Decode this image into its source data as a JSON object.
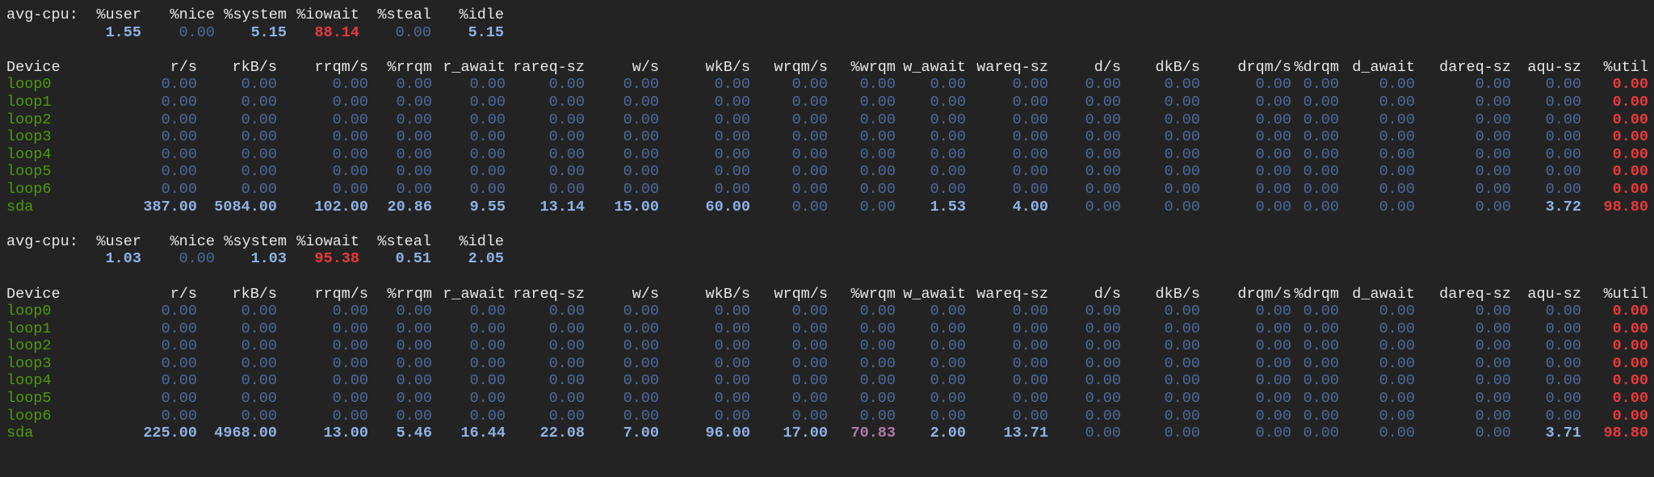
{
  "colors": {
    "background": "#232323",
    "label": "#e6e6e6",
    "zero_value": "#4d6a9c",
    "nonzero_value": "#8fb2e6",
    "critical_value": "#e83a3a",
    "warning_value": "#b07aa8",
    "device_name": "#4e9a06"
  },
  "cpu_label": "avg-cpu:",
  "cpu_headers": [
    "%user",
    "%nice",
    "%system",
    "%iowait",
    "%steal",
    "%idle"
  ],
  "device_headers": [
    "Device",
    "r/s",
    "rkB/s",
    "rrqm/s",
    "%rrqm",
    "r_await",
    "rareq-sz",
    "w/s",
    "wkB/s",
    "wrqm/s",
    "%wrqm",
    "w_await",
    "wareq-sz",
    "d/s",
    "dkB/s",
    "drqm/s",
    "%drqm",
    "d_await",
    "dareq-sz",
    "aqu-sz",
    "%util"
  ],
  "reports": [
    {
      "cpu_values": [
        "1.55",
        "0.00",
        "5.15",
        "88.14",
        "0.00",
        "5.15"
      ],
      "devices": [
        {
          "name": "loop0",
          "values": [
            "0.00",
            "0.00",
            "0.00",
            "0.00",
            "0.00",
            "0.00",
            "0.00",
            "0.00",
            "0.00",
            "0.00",
            "0.00",
            "0.00",
            "0.00",
            "0.00",
            "0.00",
            "0.00",
            "0.00",
            "0.00",
            "0.00",
            "0.00"
          ]
        },
        {
          "name": "loop1",
          "values": [
            "0.00",
            "0.00",
            "0.00",
            "0.00",
            "0.00",
            "0.00",
            "0.00",
            "0.00",
            "0.00",
            "0.00",
            "0.00",
            "0.00",
            "0.00",
            "0.00",
            "0.00",
            "0.00",
            "0.00",
            "0.00",
            "0.00",
            "0.00"
          ]
        },
        {
          "name": "loop2",
          "values": [
            "0.00",
            "0.00",
            "0.00",
            "0.00",
            "0.00",
            "0.00",
            "0.00",
            "0.00",
            "0.00",
            "0.00",
            "0.00",
            "0.00",
            "0.00",
            "0.00",
            "0.00",
            "0.00",
            "0.00",
            "0.00",
            "0.00",
            "0.00"
          ]
        },
        {
          "name": "loop3",
          "values": [
            "0.00",
            "0.00",
            "0.00",
            "0.00",
            "0.00",
            "0.00",
            "0.00",
            "0.00",
            "0.00",
            "0.00",
            "0.00",
            "0.00",
            "0.00",
            "0.00",
            "0.00",
            "0.00",
            "0.00",
            "0.00",
            "0.00",
            "0.00"
          ]
        },
        {
          "name": "loop4",
          "values": [
            "0.00",
            "0.00",
            "0.00",
            "0.00",
            "0.00",
            "0.00",
            "0.00",
            "0.00",
            "0.00",
            "0.00",
            "0.00",
            "0.00",
            "0.00",
            "0.00",
            "0.00",
            "0.00",
            "0.00",
            "0.00",
            "0.00",
            "0.00"
          ]
        },
        {
          "name": "loop5",
          "values": [
            "0.00",
            "0.00",
            "0.00",
            "0.00",
            "0.00",
            "0.00",
            "0.00",
            "0.00",
            "0.00",
            "0.00",
            "0.00",
            "0.00",
            "0.00",
            "0.00",
            "0.00",
            "0.00",
            "0.00",
            "0.00",
            "0.00",
            "0.00"
          ]
        },
        {
          "name": "loop6",
          "values": [
            "0.00",
            "0.00",
            "0.00",
            "0.00",
            "0.00",
            "0.00",
            "0.00",
            "0.00",
            "0.00",
            "0.00",
            "0.00",
            "0.00",
            "0.00",
            "0.00",
            "0.00",
            "0.00",
            "0.00",
            "0.00",
            "0.00",
            "0.00"
          ]
        },
        {
          "name": "sda",
          "values": [
            "387.00",
            "5084.00",
            "102.00",
            "20.86",
            "9.55",
            "13.14",
            "15.00",
            "60.00",
            "0.00",
            "0.00",
            "1.53",
            "4.00",
            "0.00",
            "0.00",
            "0.00",
            "0.00",
            "0.00",
            "0.00",
            "3.72",
            "98.80"
          ]
        }
      ]
    },
    {
      "cpu_values": [
        "1.03",
        "0.00",
        "1.03",
        "95.38",
        "0.51",
        "2.05"
      ],
      "devices": [
        {
          "name": "loop0",
          "values": [
            "0.00",
            "0.00",
            "0.00",
            "0.00",
            "0.00",
            "0.00",
            "0.00",
            "0.00",
            "0.00",
            "0.00",
            "0.00",
            "0.00",
            "0.00",
            "0.00",
            "0.00",
            "0.00",
            "0.00",
            "0.00",
            "0.00",
            "0.00"
          ]
        },
        {
          "name": "loop1",
          "values": [
            "0.00",
            "0.00",
            "0.00",
            "0.00",
            "0.00",
            "0.00",
            "0.00",
            "0.00",
            "0.00",
            "0.00",
            "0.00",
            "0.00",
            "0.00",
            "0.00",
            "0.00",
            "0.00",
            "0.00",
            "0.00",
            "0.00",
            "0.00"
          ]
        },
        {
          "name": "loop2",
          "values": [
            "0.00",
            "0.00",
            "0.00",
            "0.00",
            "0.00",
            "0.00",
            "0.00",
            "0.00",
            "0.00",
            "0.00",
            "0.00",
            "0.00",
            "0.00",
            "0.00",
            "0.00",
            "0.00",
            "0.00",
            "0.00",
            "0.00",
            "0.00"
          ]
        },
        {
          "name": "loop3",
          "values": [
            "0.00",
            "0.00",
            "0.00",
            "0.00",
            "0.00",
            "0.00",
            "0.00",
            "0.00",
            "0.00",
            "0.00",
            "0.00",
            "0.00",
            "0.00",
            "0.00",
            "0.00",
            "0.00",
            "0.00",
            "0.00",
            "0.00",
            "0.00"
          ]
        },
        {
          "name": "loop4",
          "values": [
            "0.00",
            "0.00",
            "0.00",
            "0.00",
            "0.00",
            "0.00",
            "0.00",
            "0.00",
            "0.00",
            "0.00",
            "0.00",
            "0.00",
            "0.00",
            "0.00",
            "0.00",
            "0.00",
            "0.00",
            "0.00",
            "0.00",
            "0.00"
          ]
        },
        {
          "name": "loop5",
          "values": [
            "0.00",
            "0.00",
            "0.00",
            "0.00",
            "0.00",
            "0.00",
            "0.00",
            "0.00",
            "0.00",
            "0.00",
            "0.00",
            "0.00",
            "0.00",
            "0.00",
            "0.00",
            "0.00",
            "0.00",
            "0.00",
            "0.00",
            "0.00"
          ]
        },
        {
          "name": "loop6",
          "values": [
            "0.00",
            "0.00",
            "0.00",
            "0.00",
            "0.00",
            "0.00",
            "0.00",
            "0.00",
            "0.00",
            "0.00",
            "0.00",
            "0.00",
            "0.00",
            "0.00",
            "0.00",
            "0.00",
            "0.00",
            "0.00",
            "0.00",
            "0.00"
          ]
        },
        {
          "name": "sda",
          "values": [
            "225.00",
            "4968.00",
            "13.00",
            "5.46",
            "16.44",
            "22.08",
            "7.00",
            "96.00",
            "17.00",
            "70.83",
            "2.00",
            "13.71",
            "0.00",
            "0.00",
            "0.00",
            "0.00",
            "0.00",
            "0.00",
            "3.71",
            "98.80"
          ]
        }
      ]
    }
  ]
}
